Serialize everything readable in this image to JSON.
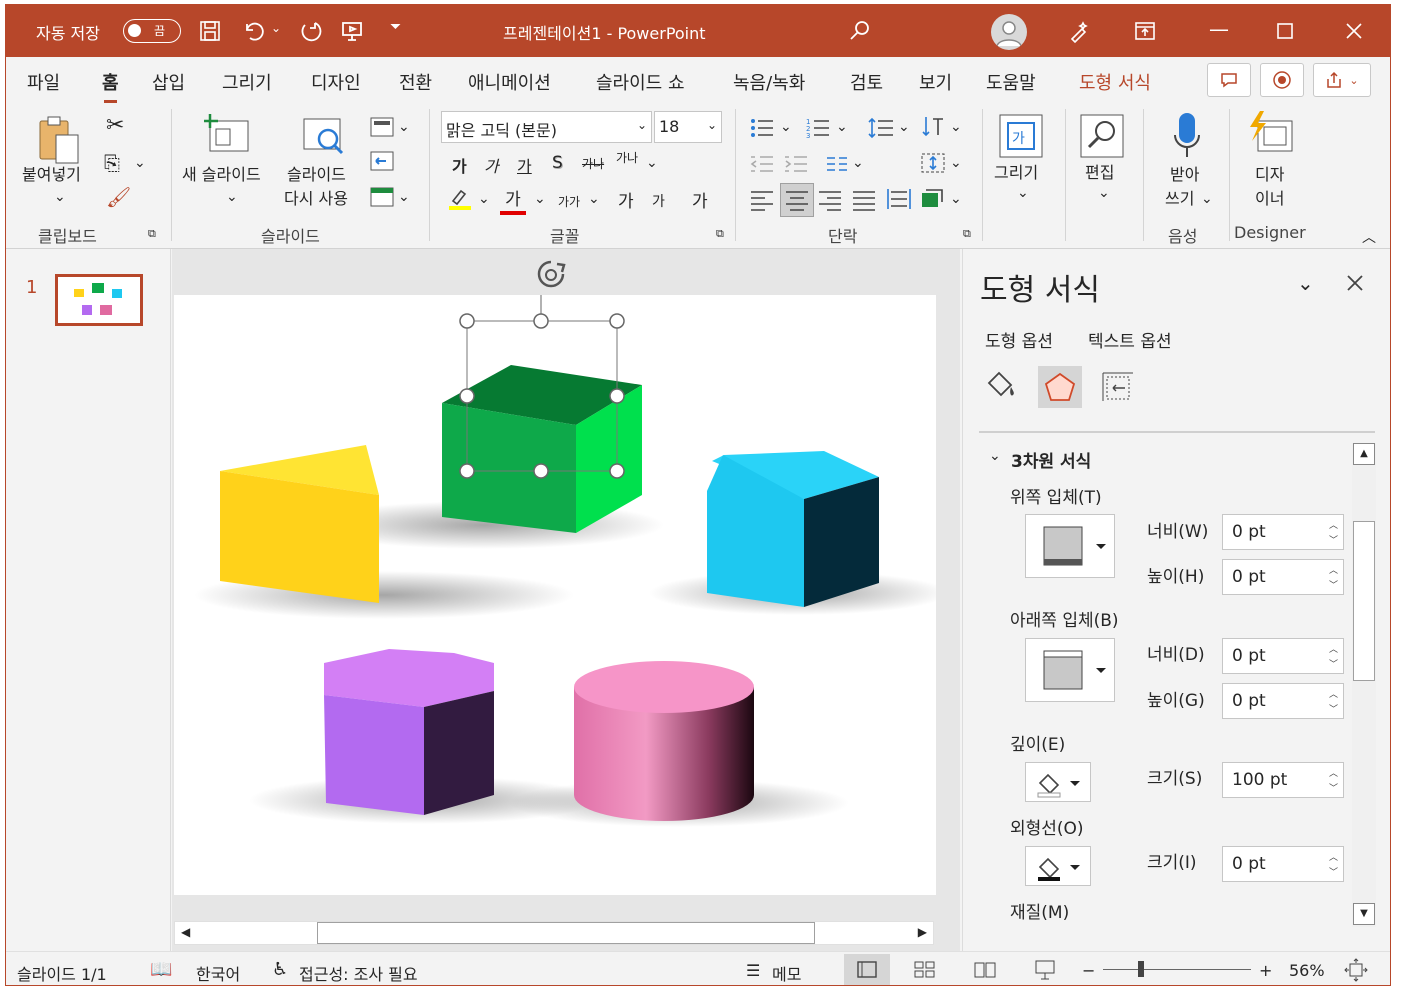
{
  "titlebar": {
    "autosave_label": "자동 저장",
    "autosave_state": "끔",
    "document_title": "프레젠테이션1  -  PowerPoint"
  },
  "tabs": [
    {
      "label": "파일"
    },
    {
      "label": "홈"
    },
    {
      "label": "삽입"
    },
    {
      "label": "그리기"
    },
    {
      "label": "디자인"
    },
    {
      "label": "전환"
    },
    {
      "label": "애니메이션"
    },
    {
      "label": "슬라이드 쇼"
    },
    {
      "label": "녹음/녹화"
    },
    {
      "label": "검토"
    },
    {
      "label": "보기"
    },
    {
      "label": "도움말"
    },
    {
      "label": "도형 서식"
    }
  ],
  "ribbon": {
    "paste_label": "붙여넣기",
    "clipboard_group": "클립보드",
    "new_slide_label": "새 슬라이드",
    "reuse_slide_line1": "슬라이드",
    "reuse_slide_line2": "다시 사용",
    "slides_group": "슬라이드",
    "font_name": "맑은 고딕 (본문)",
    "font_size": "18",
    "font_group": "글꼴",
    "bold": "가",
    "italic": "가",
    "underline": "가",
    "strike": "S",
    "strikethrough": "가나",
    "char_spacing": "가나",
    "font_color": "가",
    "change_case": "가가",
    "grow_font": "가",
    "shrink_font": "가",
    "clear_format": "가",
    "paragraph_group": "단락",
    "draw_label": "그리기",
    "edit_label": "편집",
    "dictate_line1": "받아",
    "dictate_line2": "쓰기",
    "voice_group": "음성",
    "designer_line1": "디자",
    "designer_line2": "이너",
    "designer_group": "Designer"
  },
  "slides_pane": {
    "slide_number": "1"
  },
  "format_panel": {
    "title": "도형 서식",
    "tab_shape": "도형 옵션",
    "tab_text": "텍스트 옵션",
    "section": "3차원 서식",
    "top_bevel": "위쪽 입체(T)",
    "width_w": "너비(W)",
    "height_h": "높이(H)",
    "bottom_bevel": "아래쪽 입체(B)",
    "width_d": "너비(D)",
    "height_g": "높이(G)",
    "depth": "깊이(E)",
    "size_s": "크기(S)",
    "contour": "외형선(O)",
    "size_i": "크기(I)",
    "material": "재질(M)",
    "values": {
      "top_width": "0 pt",
      "top_height": "0 pt",
      "bottom_width": "0 pt",
      "bottom_height": "0 pt",
      "depth_size": "100 pt",
      "contour_size": "0 pt"
    }
  },
  "statusbar": {
    "slide_info": "슬라이드 1/1",
    "language": "한국어",
    "accessibility": "접근성: 조사 필요",
    "notes": "메모",
    "zoom": "56%"
  },
  "colors": {
    "accent": "#b7472a",
    "cube_green": "#0ea94a",
    "prism_yellow": "#ffd21a",
    "pentagon_blue": "#1ec8f0",
    "hexagon_purple": "#b36af0",
    "cylinder_pink": "#e06aa0"
  }
}
